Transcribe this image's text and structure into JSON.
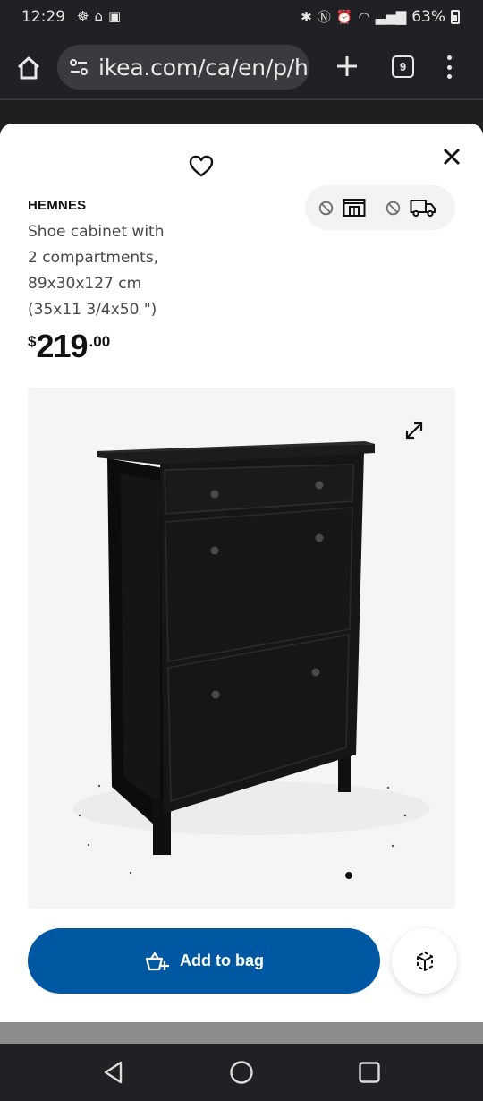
{
  "status_bar": {
    "time": "12:29",
    "battery": "63%"
  },
  "browser": {
    "url": "ikea.com/ca/en/p/he",
    "tab_count": "9"
  },
  "product": {
    "brand": "HEMNES",
    "description_lines": [
      "Shoe cabinet with",
      "2 compartments,",
      "89x30x127 cm",
      "(35x11 3/4x50 \")"
    ],
    "price": {
      "currency": "$",
      "integer": "219",
      "decimal": ".00"
    }
  },
  "actions": {
    "add_to_bag": "Add to bag"
  },
  "colors": {
    "primary": "#0058a3",
    "chrome": "#202124",
    "pill": "#3a3b3e",
    "cabinet": "#141414"
  },
  "icons": {
    "favorite": "heart-icon",
    "close": "close-icon",
    "store": "store-icon",
    "delivery": "truck-icon",
    "unavailable": "ban-icon",
    "expand": "expand-icon",
    "bag": "bag-icon",
    "ar": "ar-view-icon"
  }
}
